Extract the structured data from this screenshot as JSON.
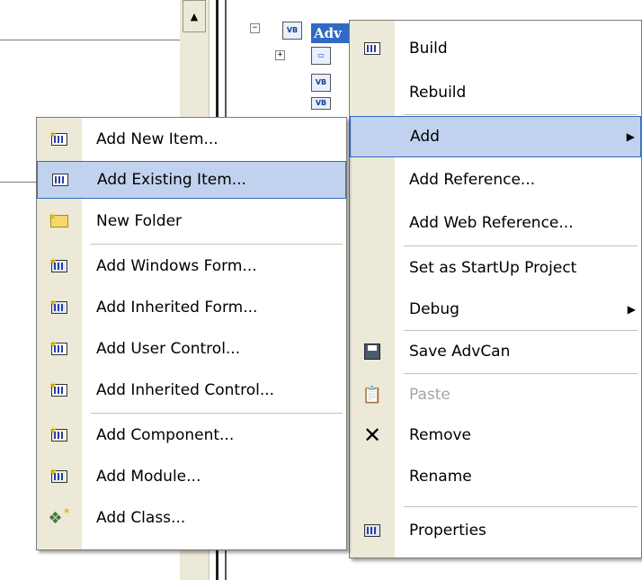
{
  "tree": {
    "selected_node": "Adv",
    "node_icons": [
      "vb-project-icon",
      "folder-ref-icon",
      "vb-file-icon",
      "vb-file-icon"
    ]
  },
  "context_menu": {
    "items": [
      {
        "label": "Build",
        "icon": "build-icon"
      },
      {
        "label": "Rebuild",
        "icon": ""
      },
      {
        "label": "Add",
        "icon": "",
        "submenu": true,
        "highlighted": true
      },
      {
        "label": "Add Reference...",
        "icon": ""
      },
      {
        "label": "Add Web Reference...",
        "icon": ""
      },
      {
        "label": "Set as StartUp Project",
        "icon": ""
      },
      {
        "label": "Debug",
        "icon": "",
        "submenu": true
      },
      {
        "label": "Save AdvCan",
        "icon": "save-icon"
      },
      {
        "label": "Paste",
        "icon": "paste-icon",
        "disabled": true
      },
      {
        "label": "Remove",
        "icon": "remove-icon"
      },
      {
        "label": "Rename",
        "icon": ""
      },
      {
        "label": "Properties",
        "icon": "properties-icon"
      }
    ]
  },
  "add_submenu": {
    "items": [
      {
        "label": "Add New Item...",
        "icon": "new-item-icon"
      },
      {
        "label": "Add Existing Item...",
        "icon": "existing-item-icon",
        "highlighted": true
      },
      {
        "label": "New Folder",
        "icon": "new-folder-icon"
      },
      {
        "label": "Add Windows Form...",
        "icon": "windows-form-icon"
      },
      {
        "label": "Add Inherited Form...",
        "icon": "inherited-form-icon"
      },
      {
        "label": "Add User Control...",
        "icon": "user-control-icon"
      },
      {
        "label": "Add Inherited Control...",
        "icon": "inherited-control-icon"
      },
      {
        "label": "Add Component...",
        "icon": "component-icon"
      },
      {
        "label": "Add Module...",
        "icon": "module-icon"
      },
      {
        "label": "Add Class...",
        "icon": "class-icon"
      }
    ]
  },
  "colors": {
    "highlight_bg": "#c1d2ee",
    "highlight_border": "#316ac5",
    "gutter": "#ece9d8",
    "selection": "#316ac5"
  }
}
